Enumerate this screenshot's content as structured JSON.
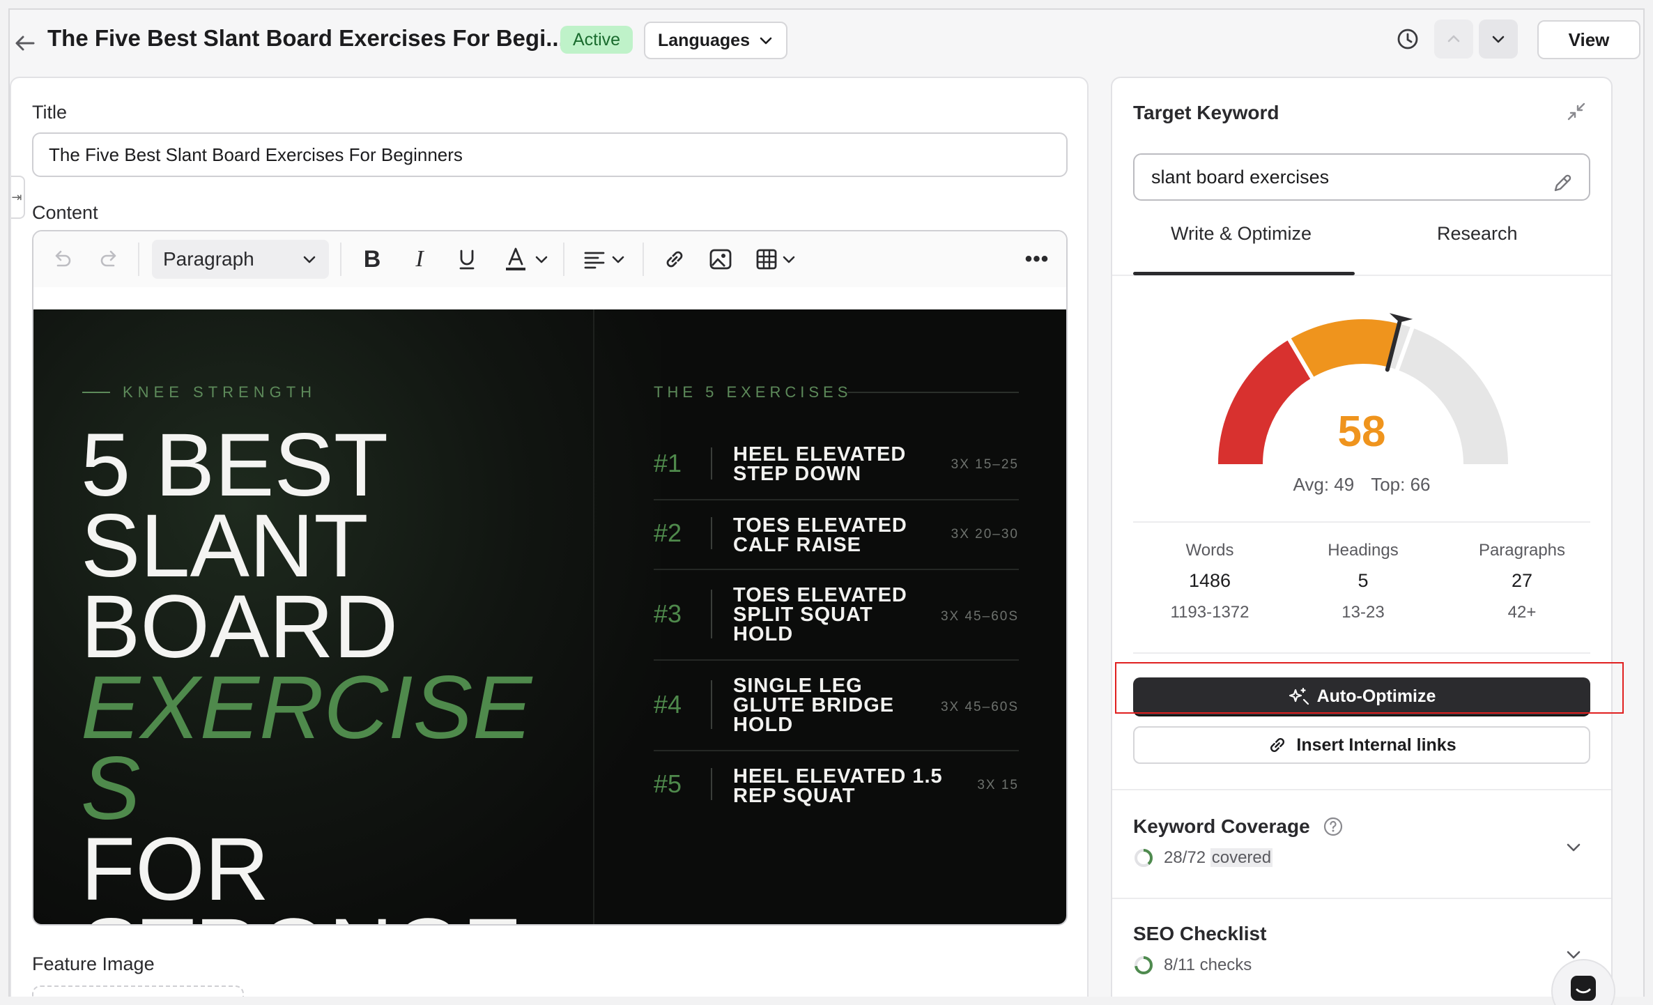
{
  "header": {
    "doc_title": "The Five Best Slant Board Exercises For Begi...",
    "status_badge": "Active",
    "languages_label": "Languages",
    "view_label": "View"
  },
  "editor": {
    "title_label": "Title",
    "title_value": "The Five Best Slant Board Exercises For Beginners",
    "content_label": "Content",
    "block_type": "Paragraph",
    "feature_image_label": "Feature Image"
  },
  "artwork": {
    "kicker": "KNEE STRENGTH",
    "hero_line1": "5 BEST",
    "hero_line2": "SLANT",
    "hero_line3": "BOARD",
    "hero_line4": "EXERCISE",
    "hero_line5": "S",
    "hero_line6": "FOR",
    "hero_line7": "STRONGE",
    "exercises_heading": "THE 5 EXERCISES",
    "exercises": [
      {
        "num": "#1",
        "line1": "HEEL ELEVATED",
        "line2": "STEP DOWN",
        "line3": "",
        "reps": "3X 15–25"
      },
      {
        "num": "#2",
        "line1": "TOES ELEVATED",
        "line2": "CALF RAISE",
        "line3": "",
        "reps": "3X 20–30"
      },
      {
        "num": "#3",
        "line1": "TOES ELEVATED",
        "line2": "SPLIT SQUAT",
        "line3": "HOLD",
        "reps": "3X 45–60S"
      },
      {
        "num": "#4",
        "line1": "SINGLE LEG",
        "line2": "GLUTE BRIDGE",
        "line3": "HOLD",
        "reps": "3X 45–60S"
      },
      {
        "num": "#5",
        "line1": "HEEL ELEVATED 1.5",
        "line2": "REP SQUAT",
        "line3": "",
        "reps": "3X 15"
      }
    ]
  },
  "seo_panel": {
    "target_keyword_title": "Target Keyword",
    "keyword_value": "slant board exercises",
    "tabs": [
      "Write & Optimize",
      "Research"
    ],
    "active_tab": "Write & Optimize",
    "score": "58",
    "score_value": 58,
    "avg_label": "Avg: 49",
    "top_label": "Top: 66",
    "score_color": "#ef941d",
    "stats": [
      {
        "label": "Words",
        "value": "1486",
        "range": "1193-1372"
      },
      {
        "label": "Headings",
        "value": "5",
        "range": "13-23"
      },
      {
        "label": "Paragraphs",
        "value": "27",
        "range": "42+"
      }
    ],
    "auto_optimize_label": "Auto-Optimize",
    "insert_links_label": "Insert Internal links",
    "keyword_coverage_title": "Keyword Coverage",
    "keyword_coverage_count": "28/72",
    "keyword_coverage_suffix": "covered",
    "keyword_coverage_fraction": 0.389,
    "seo_checklist_title": "SEO Checklist",
    "seo_checklist_status": "8/11 checks",
    "seo_checklist_fraction": 0.727
  }
}
